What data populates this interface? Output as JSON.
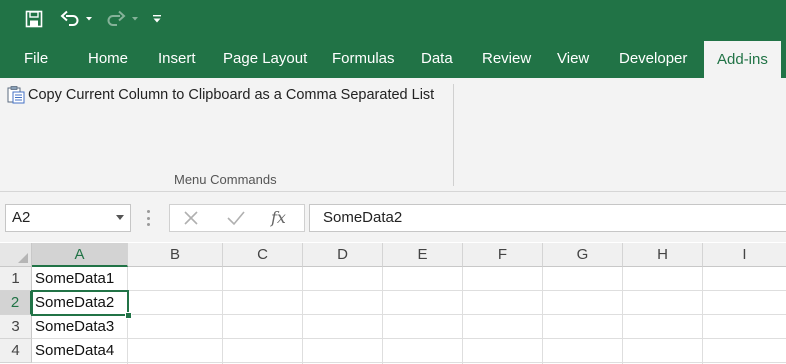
{
  "qat": {
    "save_icon": "save-icon",
    "undo_icon": "undo-icon",
    "redo_icon": "redo-icon",
    "customize_icon": "customize-qat-icon"
  },
  "tabs": [
    {
      "label": "File"
    },
    {
      "label": "Home"
    },
    {
      "label": "Insert"
    },
    {
      "label": "Page Layout"
    },
    {
      "label": "Formulas"
    },
    {
      "label": "Data"
    },
    {
      "label": "Review"
    },
    {
      "label": "View"
    },
    {
      "label": "Developer"
    },
    {
      "label": "Add-ins",
      "active": true
    }
  ],
  "ribbon": {
    "command_label": "Copy Current Column to Clipboard as a Comma Separated List",
    "command_icon": "clipboard-list-icon",
    "group_label": "Menu Commands"
  },
  "formula_bar": {
    "name_box": "A2",
    "fx_label": "fx",
    "formula": "SomeData2"
  },
  "grid": {
    "columns": [
      "A",
      "B",
      "C",
      "D",
      "E",
      "F",
      "G",
      "H",
      "I"
    ],
    "selected_column": "A",
    "rows": [
      "1",
      "2",
      "3",
      "4"
    ],
    "selected_row": "2",
    "cells": [
      "SomeData1",
      "SomeData2",
      "SomeData3",
      "SomeData4"
    ],
    "active_cell": "A2"
  },
  "colors": {
    "accent": "#217346",
    "ribbon_bg": "#f3f3f3"
  }
}
